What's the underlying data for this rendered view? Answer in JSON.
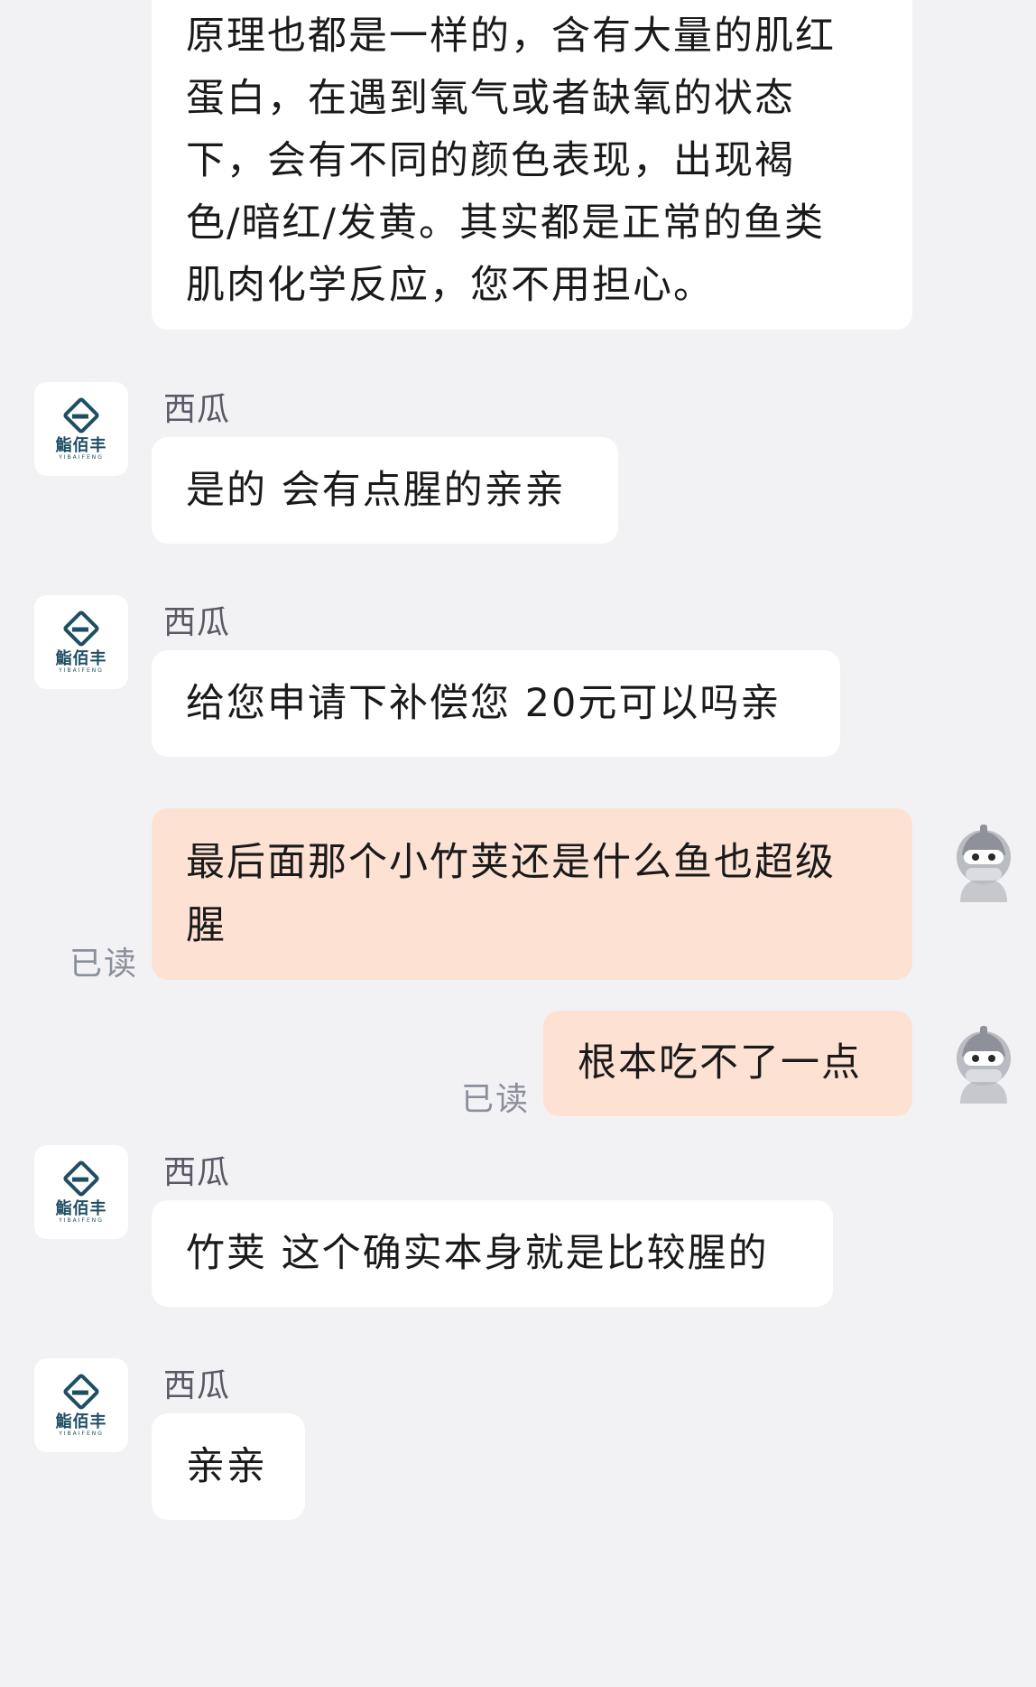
{
  "colors": {
    "background": "#f2f2f5",
    "incoming_bubble": "#ffffff",
    "outgoing_bubble": "#fde2d4",
    "read_text": "#8a8f9a",
    "brand": "#1f4e63"
  },
  "shop_avatar": {
    "brand": "鮨佰丰",
    "brand_sub": "YIBAIFENG"
  },
  "messages": [
    {
      "lines": [
        "原理也都是一样的，含有大量的肌红",
        "蛋白，在遇到氧气或者缺氧的状态",
        "下，会有不同的颜色表现，出现褐",
        "色/暗红/发黄。其实都是正常的鱼类",
        "肌肉化学反应，您不用担心。"
      ]
    },
    {
      "sender": "西瓜",
      "text": "是的 会有点腥的亲亲"
    },
    {
      "sender": "西瓜",
      "text": "给您申请下补偿您 20元可以吗亲"
    },
    {
      "lines": [
        "最后面那个小竹荚还是什么鱼也超级",
        "腥"
      ],
      "status": "已读"
    },
    {
      "text": "根本吃不了一点",
      "status": "已读"
    },
    {
      "sender": "西瓜",
      "text": "竹荚 这个确实本身就是比较腥的"
    },
    {
      "sender": "西瓜",
      "text": "亲亲"
    }
  ]
}
